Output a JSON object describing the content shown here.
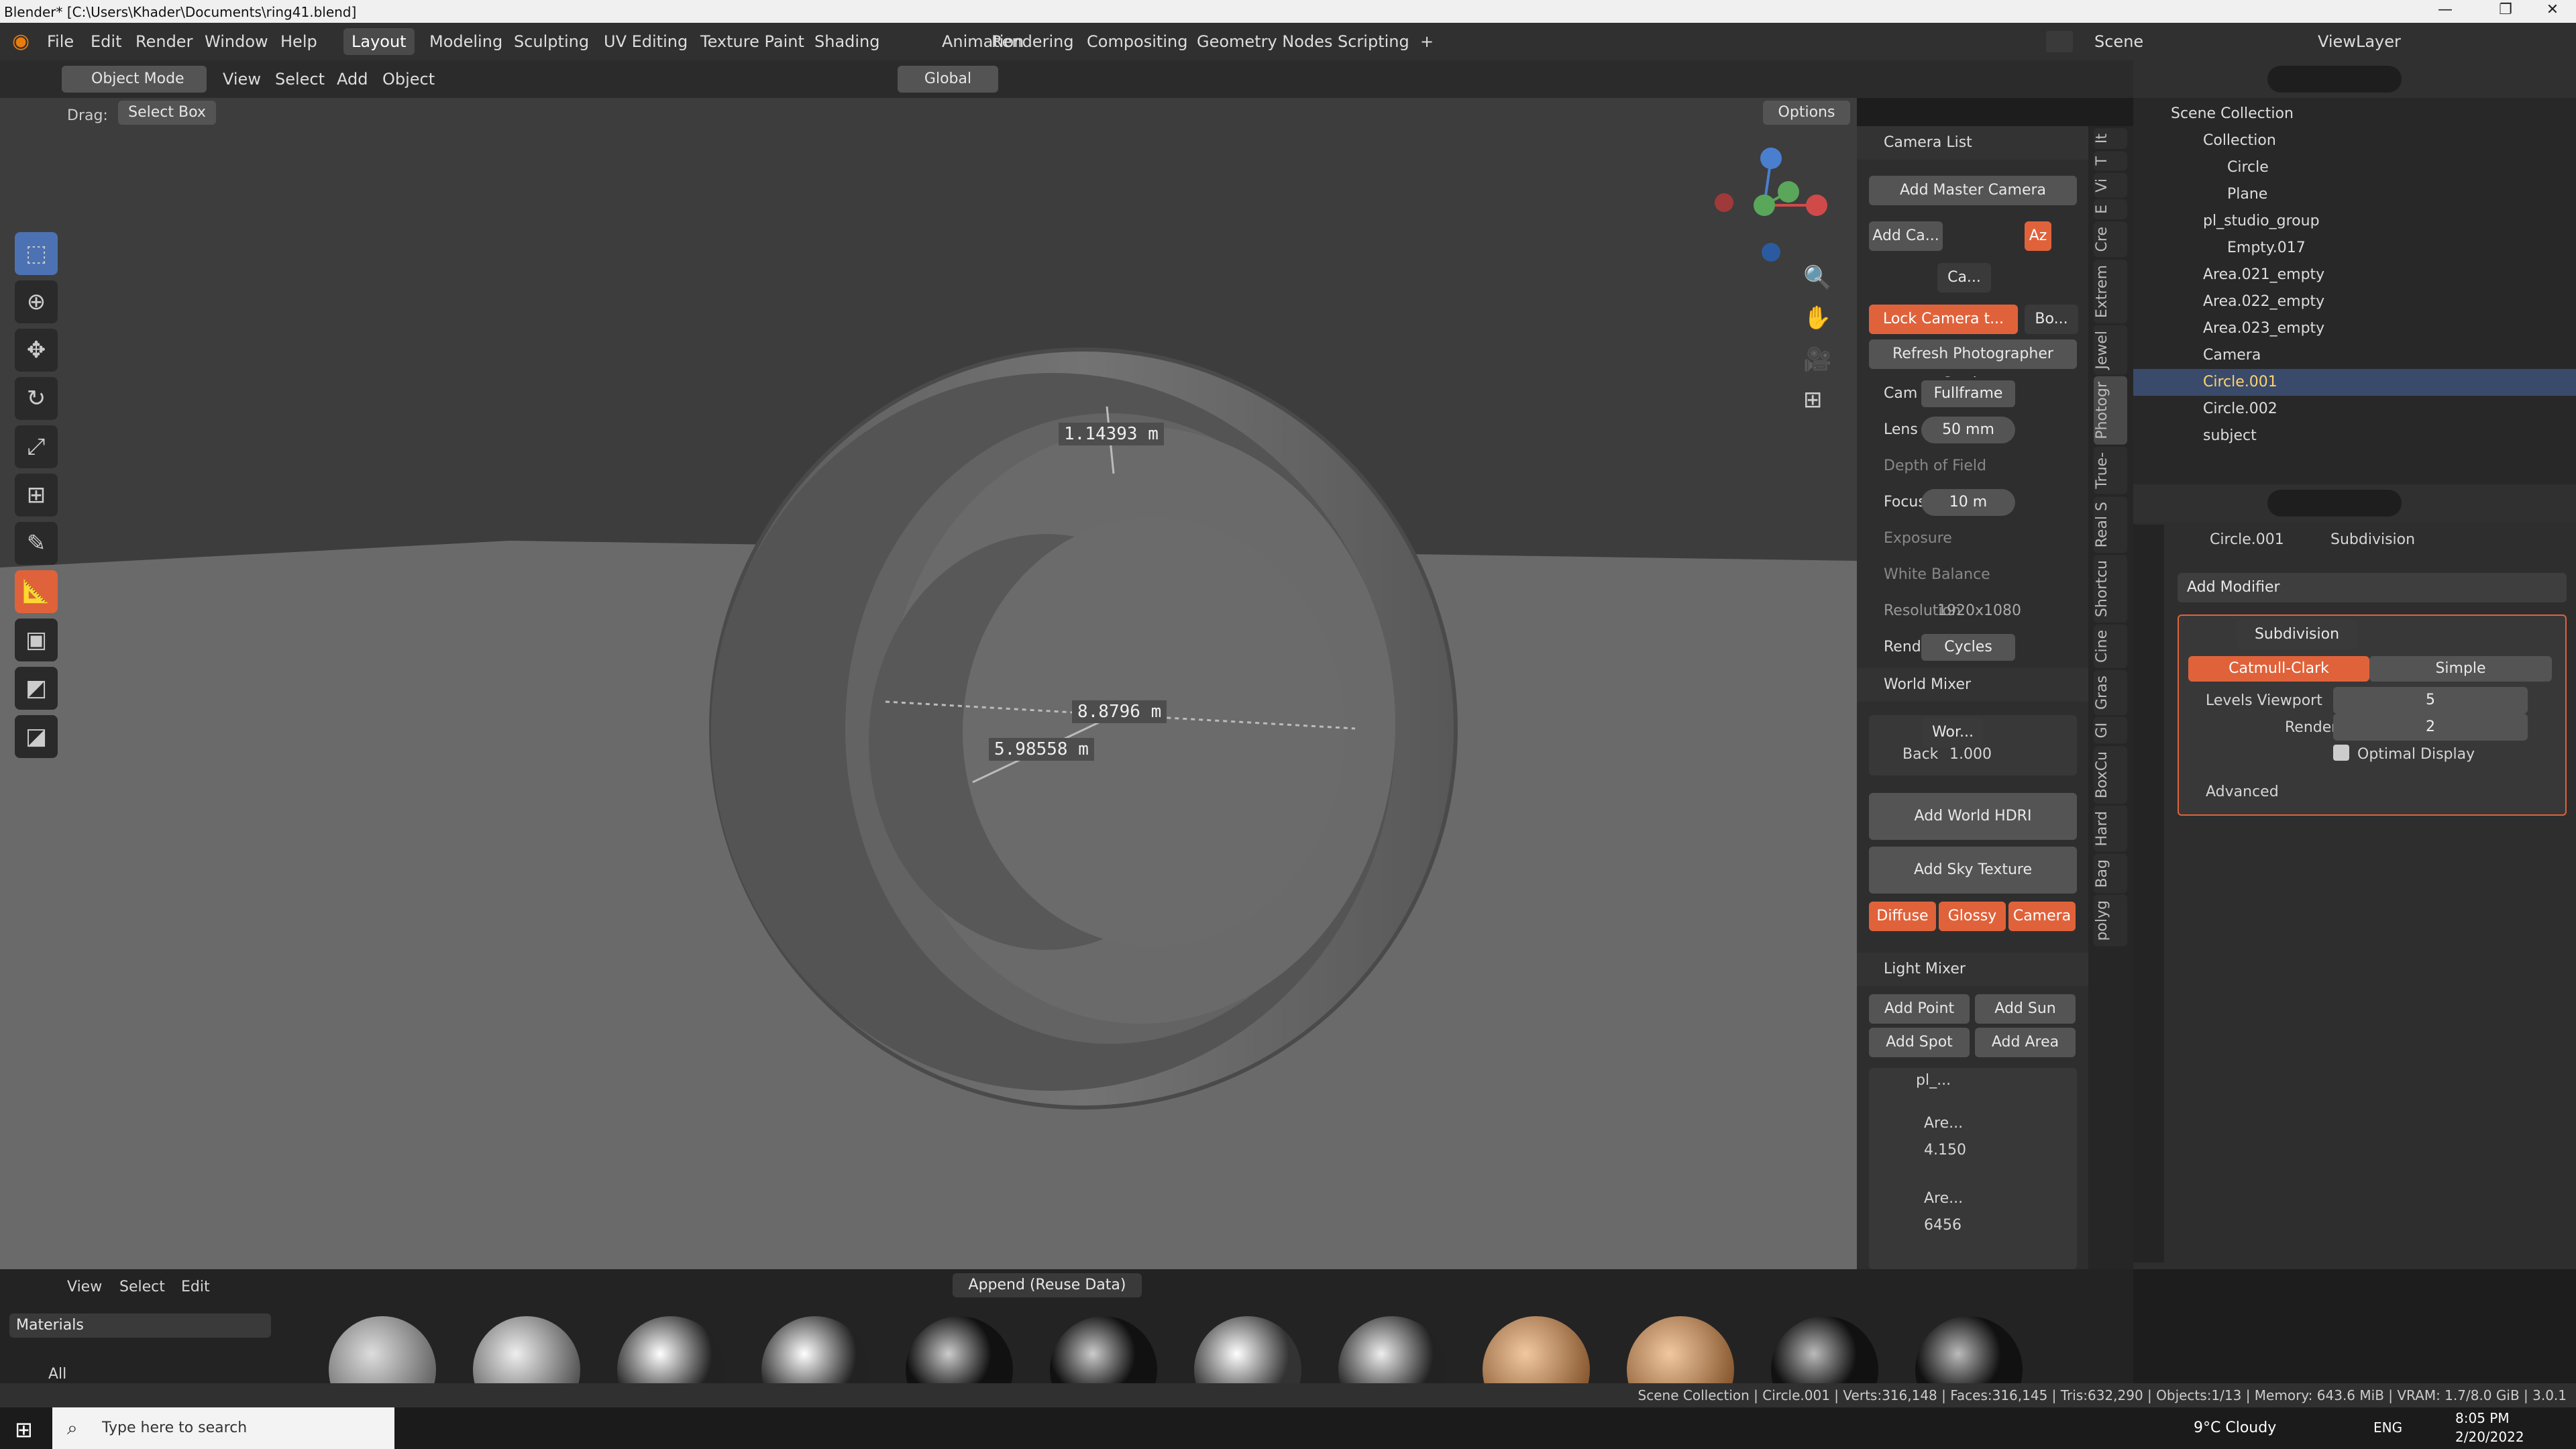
{
  "window": {
    "title": "Blender* [C:\\Users\\Khader\\Documents\\ring41.blend]"
  },
  "menu": [
    "File",
    "Edit",
    "Render",
    "Window",
    "Help"
  ],
  "workspaces": [
    "Layout",
    "Modeling",
    "Sculpting",
    "UV Editing",
    "Texture Paint",
    "Shading",
    "Animation",
    "Rendering",
    "Compositing",
    "Geometry Nodes",
    "Scripting"
  ],
  "scene": {
    "label": "Scene",
    "viewlayer": "ViewLayer"
  },
  "toolbar": {
    "mode": "Object Mode",
    "view": "View",
    "select": "Select",
    "add": "Add",
    "object": "Object",
    "transform": "Global",
    "drag_label": "Drag:",
    "drag_value": "Select Box",
    "options": "Options"
  },
  "viewport": {
    "measure1": "1.14393 m",
    "measure2": "8.8796 m",
    "measure3": "5.98558 m"
  },
  "npanel": {
    "camera_list": "Camera List",
    "add_master_camera": "Add Master Camera",
    "add_camera": "Add Ca...",
    "cam_name": "Ca...",
    "lock_camera": "Lock Camera t...",
    "bo": "Bo...",
    "refresh": "Refresh Photographer Settings",
    "rows": [
      {
        "label": "Cam",
        "value": "Fullframe"
      },
      {
        "label": "Lens",
        "value": "50 mm"
      },
      {
        "label": "Depth of Field",
        "value": ""
      },
      {
        "label": "Focus",
        "value": "10 m"
      },
      {
        "label": "Exposure",
        "value": ""
      },
      {
        "label": "White Balance",
        "value": ""
      },
      {
        "label": "Resolution",
        "value": "1920x1080"
      },
      {
        "label": "Rend",
        "value": "Cycles"
      }
    ],
    "world_mixer": "World Mixer",
    "world_name": "Wor...",
    "back_label": "Back",
    "back_value": "1.000",
    "add_world_hdri": "Add World HDRI",
    "add_sky": "Add Sky Texture",
    "diffuse": "Diffuse",
    "glossy": "Glossy",
    "camera": "Camera",
    "light_mixer": "Light Mixer",
    "add_point": "Add Point",
    "add_sun": "Add Sun",
    "add_spot": "Add Spot",
    "add_area": "Add Area",
    "group": "pl_...",
    "light1": "Are...",
    "light1_val": "4.150",
    "light2": "Are...",
    "light2_val": "6456"
  },
  "ntabs": [
    "It",
    "T",
    "Vi",
    "E",
    "Cre",
    "Extrem",
    "Jewel",
    "Photogr",
    "True-",
    "Real S",
    "Shortcu",
    "Cine",
    "Gras",
    "GI",
    "BoxCu",
    "Hard",
    "Bag",
    "polyg"
  ],
  "outliner": {
    "root": "Scene Collection",
    "items": [
      {
        "name": "Collection",
        "indent": 1
      },
      {
        "name": "Circle",
        "indent": 2
      },
      {
        "name": "Plane",
        "indent": 2
      },
      {
        "name": "pl_studio_group",
        "indent": 1
      },
      {
        "name": "Empty.017",
        "indent": 2
      },
      {
        "name": "Area.021_empty",
        "indent": 1
      },
      {
        "name": "Area.022_empty",
        "indent": 1
      },
      {
        "name": "Area.023_empty",
        "indent": 1
      },
      {
        "name": "Camera",
        "indent": 1
      },
      {
        "name": "Circle.001",
        "indent": 1,
        "selected": true
      },
      {
        "name": "Circle.002",
        "indent": 1
      },
      {
        "name": "subject",
        "indent": 1
      }
    ]
  },
  "properties": {
    "breadcrumb_obj": "Circle.001",
    "breadcrumb_mod": "Subdivision",
    "add_modifier": "Add Modifier",
    "modifier_name": "Subdivision",
    "catmull": "Catmull-Clark",
    "simple": "Simple",
    "levels_viewport_label": "Levels Viewport",
    "levels_viewport": "5",
    "render_label": "Render",
    "render_val": "2",
    "optimal": "Optimal Display",
    "advanced": "Advanced"
  },
  "assets": {
    "view": "View",
    "select": "Select",
    "edit": "Edit",
    "append": "Append (Reuse Data)",
    "category": "Materials",
    "all": "All"
  },
  "status": {
    "text": "Scene Collection | Circle.001 | Verts:316,148 | Faces:316,145 | Tris:632,290 | Objects:1/13 | Memory: 643.6 MiB | VRAM: 1.7/8.0 GiB | 3.0.1"
  },
  "taskbar": {
    "search": "Type here to search",
    "weather": "9°C Cloudy",
    "lang": "ENG",
    "time": "8:05 PM",
    "date": "2/20/2022"
  }
}
